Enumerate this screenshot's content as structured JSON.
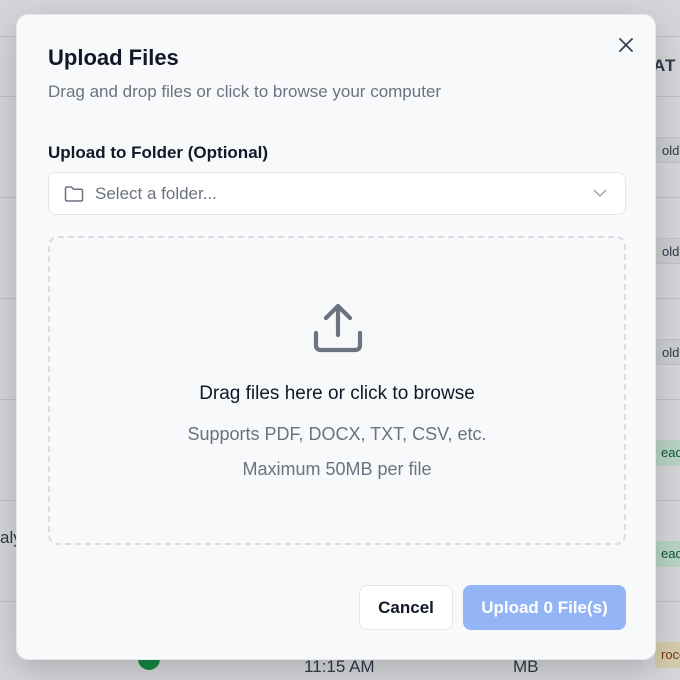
{
  "background": {
    "header_fragment": "AT",
    "pills": [
      {
        "text": "olde",
        "kind": "folder"
      },
      {
        "text": "olde",
        "kind": "folder"
      },
      {
        "text": "olde",
        "kind": "folder"
      },
      {
        "text": "eady",
        "kind": "ready"
      },
      {
        "text": "eady",
        "kind": "ready"
      },
      {
        "text": "roce",
        "kind": "processing"
      }
    ],
    "left_fragment": "aly",
    "time_fragment": "11:15 AM",
    "size_fragment": "MB"
  },
  "modal": {
    "title": "Upload Files",
    "subtitle": "Drag and drop files or click to browse your computer",
    "close_icon": "close-icon",
    "folder": {
      "label": "Upload to Folder (Optional)",
      "placeholder": "Select a folder...",
      "icon": "folder-icon"
    },
    "dropzone": {
      "icon": "upload-icon",
      "main_text": "Drag files here or click to browse",
      "supported": "Supports PDF, DOCX, TXT, CSV, etc.",
      "max_size": "Maximum 50MB per file"
    },
    "buttons": {
      "cancel": "Cancel",
      "upload": "Upload 0 File(s)"
    }
  },
  "colors": {
    "primary_disabled": "#93b4f5",
    "ready_badge": "#dcfce7",
    "processing_badge": "#fef3c7"
  }
}
